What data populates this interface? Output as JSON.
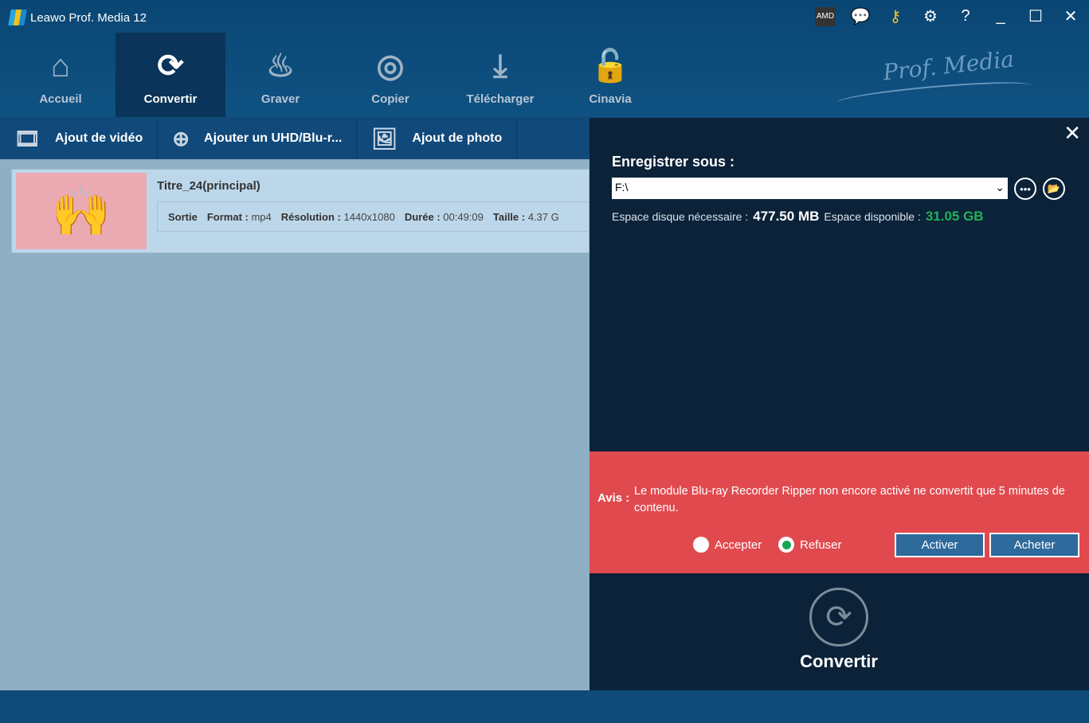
{
  "app": {
    "title": "Leawo Prof. Media 12",
    "brand": "Prof. Media"
  },
  "nav": [
    {
      "label": "Accueil",
      "icon": "home-icon"
    },
    {
      "label": "Convertir",
      "icon": "convert-icon"
    },
    {
      "label": "Graver",
      "icon": "burn-icon"
    },
    {
      "label": "Copier",
      "icon": "copy-disc-icon"
    },
    {
      "label": "Télécharger",
      "icon": "download-icon"
    },
    {
      "label": "Cinavia",
      "icon": "unlock-icon"
    }
  ],
  "toolbar": {
    "add_video": "Ajout de vidéo",
    "add_disc": "Ajouter un UHD/Blu-r...",
    "add_photo": "Ajout de photo"
  },
  "item": {
    "title": "Titre_24(principal)",
    "output_label": "Sortie",
    "format_label": "Format :",
    "format": "mp4",
    "resolution_label": "Résolution :",
    "resolution": "1440x1080",
    "duration_label": "Durée :",
    "duration": "00:49:09",
    "size_label": "Taille :",
    "size": "4.37 G"
  },
  "panel": {
    "save_label": "Enregistrer sous :",
    "path": "F:\\",
    "required_label": "Espace disque nécessaire :",
    "required": "477.50 MB",
    "available_label": "Espace disponible :",
    "available": "31.05 GB"
  },
  "notice": {
    "label": "Avis :",
    "message": "Le module Blu-ray Recorder Ripper non encore activé ne convertit que 5 minutes de contenu.",
    "accept": "Accepter",
    "refuse": "Refuser",
    "selected": "Refuser",
    "activate": "Activer",
    "buy": "Acheter"
  },
  "convert_label": "Convertir"
}
